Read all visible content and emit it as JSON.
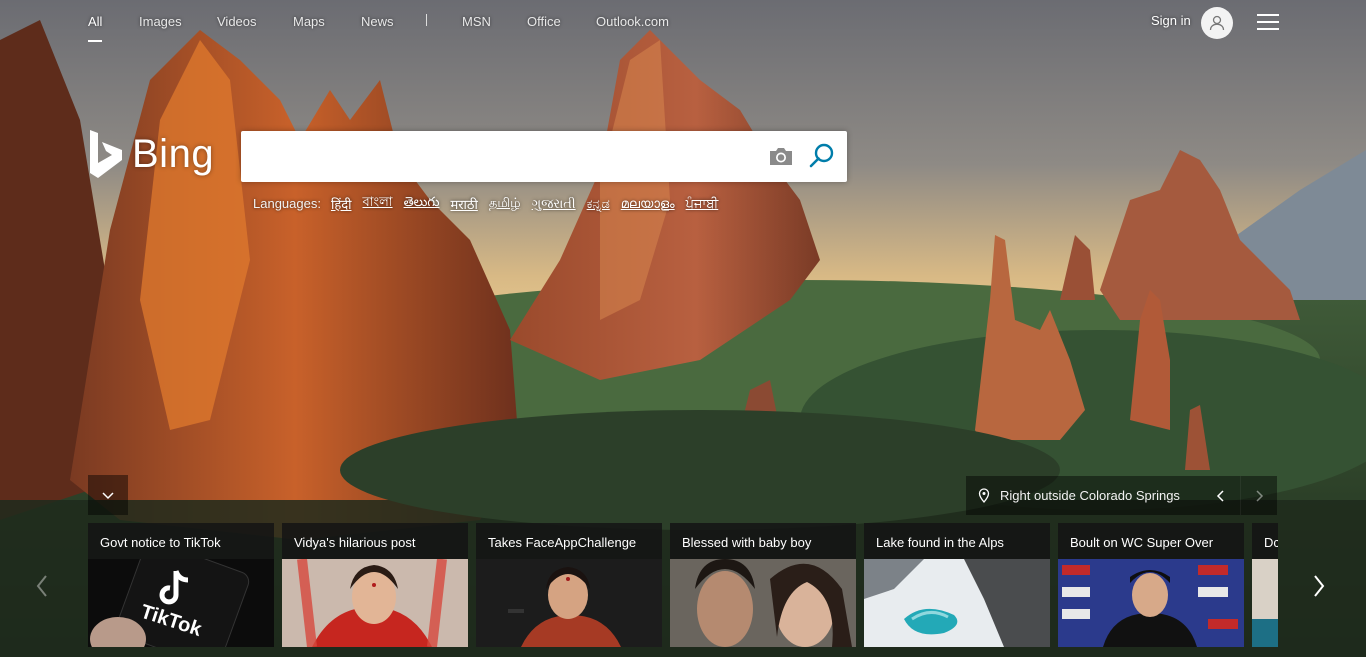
{
  "nav": {
    "items": [
      {
        "label": "All",
        "active": true
      },
      {
        "label": "Images"
      },
      {
        "label": "Videos"
      },
      {
        "label": "Maps"
      },
      {
        "label": "News"
      },
      {
        "label": "MSN"
      },
      {
        "label": "Office"
      },
      {
        "label": "Outlook.com"
      }
    ],
    "sign_in": "Sign in",
    "avatar_icon": "user-icon",
    "menu_icon": "hamburger-icon"
  },
  "logo": {
    "text": "Bing"
  },
  "search": {
    "value": "",
    "placeholder": "",
    "camera_icon": "camera-icon",
    "search_icon": "search-icon",
    "accent": "#007daa"
  },
  "languages": {
    "label": "Languages:",
    "items": [
      "हिंदी",
      "বাংলা",
      "తెలుగు",
      "मराठी",
      "தமிழ்",
      "ગુજરાતી",
      "ಕನ್ನಡ",
      "മലയാളം",
      "ਪੰਜਾਬੀ"
    ]
  },
  "image_info": {
    "location": "Right outside Colorado Springs",
    "pin_icon": "location-pin-icon"
  },
  "carousel": {
    "cards": [
      {
        "title": "Govt notice to TikTok"
      },
      {
        "title": "Vidya's hilarious post"
      },
      {
        "title": "Takes FaceAppChallenge"
      },
      {
        "title": "Blessed with baby boy"
      },
      {
        "title": "Lake found in the Alps"
      },
      {
        "title": "Boult on WC Super Over"
      },
      {
        "title": "Dc"
      }
    ]
  }
}
